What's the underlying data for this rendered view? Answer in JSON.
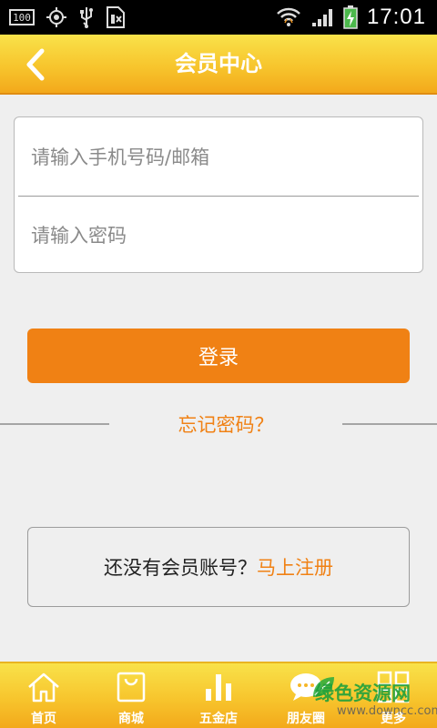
{
  "status_bar": {
    "battery_level_text": "100",
    "time": "17:01"
  },
  "header": {
    "title": "会员中心",
    "back_icon": "chevron-left-icon"
  },
  "login_form": {
    "phone_placeholder": "请输入手机号码/邮箱",
    "phone_value": "",
    "password_placeholder": "请输入密码",
    "password_value": ""
  },
  "login_button_label": "登录",
  "forgot_password_label": "忘记密码？",
  "register": {
    "prompt": "还没有会员账号？",
    "link": "马上注册"
  },
  "bottom_nav": {
    "items": [
      {
        "label": "首页",
        "icon": "home-icon"
      },
      {
        "label": "商城",
        "icon": "shopping-bag-icon"
      },
      {
        "label": "五金店",
        "icon": "bar-chart-icon"
      },
      {
        "label": "朋友圈",
        "icon": "chat-bubble-icon"
      },
      {
        "label": "更多",
        "icon": "grid-icon"
      }
    ]
  },
  "watermark": {
    "text": "绿色资源网",
    "url": "www.downcc.com"
  },
  "colors": {
    "accent": "#f08114",
    "header_top": "#f9e24a",
    "header_bottom": "#f3a91b",
    "background": "#efefef"
  }
}
